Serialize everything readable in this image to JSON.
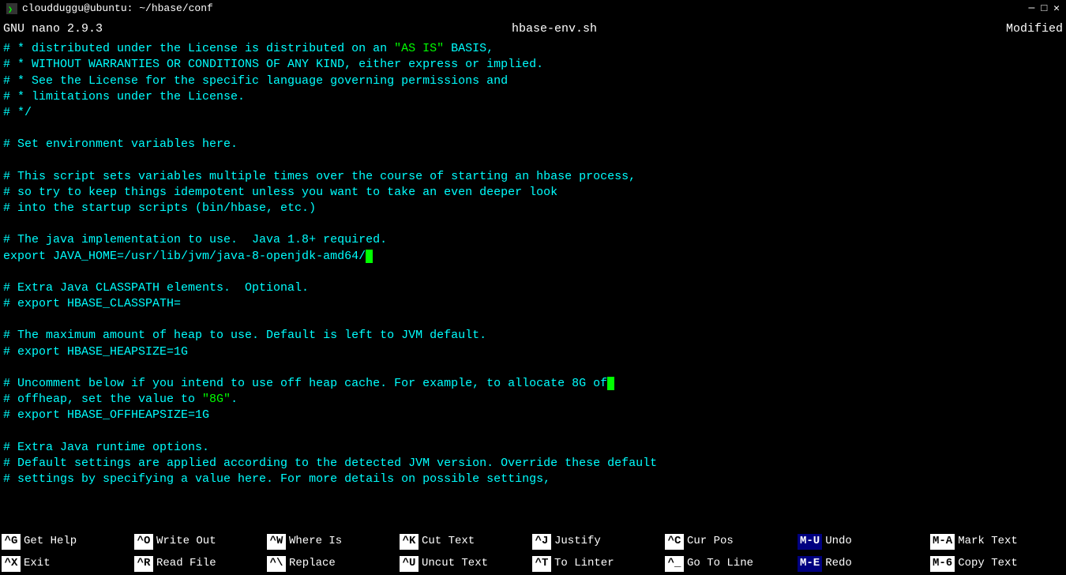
{
  "titlebar": {
    "title": "cloudduggu@ubuntu: ~/hbase/conf",
    "icon": "terminal"
  },
  "header": {
    "version": "GNU nano 2.9.3",
    "filename": "hbase-env.sh",
    "status": "Modified"
  },
  "editor": {
    "lines": [
      "# * distributed under the License is distributed on an \"AS IS\" BASIS,",
      "# * WITHOUT WARRANTIES OR CONDITIONS OF ANY KIND, either express or implied.",
      "# * See the License for the specific language governing permissions and",
      "# * limitations under the License.",
      "# */",
      "",
      "# Set environment variables here.",
      "",
      "# This script sets variables multiple times over the course of starting an hbase process,",
      "# so try to keep things idempotent unless you want to take an even deeper look",
      "# into the startup scripts (bin/hbase, etc.)",
      "",
      "# The java implementation to use.  Java 1.8+ required.",
      "export JAVA_HOME=/usr/lib/jvm/java-8-openjdk-amd64/",
      "",
      "# Extra Java CLASSPATH elements.  Optional.",
      "# export HBASE_CLASSPATH=",
      "",
      "# The maximum amount of heap to use. Default is left to JVM default.",
      "# export HBASE_HEAPSIZE=1G",
      "",
      "# Uncomment below if you intend to use off heap cache. For example, to allocate 8G of",
      "# offheap, set the value to \"8G\".",
      "# export HBASE_OFFHEAPSIZE=1G",
      "",
      "# Extra Java runtime options.",
      "# Default settings are applied according to the detected JVM version. Override these default",
      "# settings by specifying a value here. For more details on possible settings,"
    ]
  },
  "shortcuts": [
    {
      "key": "^G",
      "label": "Get Help"
    },
    {
      "key": "^O",
      "label": "Write Out"
    },
    {
      "key": "^W",
      "label": "Where Is"
    },
    {
      "key": "^K",
      "label": "Cut Text"
    },
    {
      "key": "^J",
      "label": "Justify"
    },
    {
      "key": "^C",
      "label": "Cur Pos"
    },
    {
      "key": "M-U",
      "label": "Undo"
    },
    {
      "key": "M-A",
      "label": "Mark Text"
    },
    {
      "key": "^X",
      "label": "Exit"
    },
    {
      "key": "^R",
      "label": "Read File"
    },
    {
      "key": "^\\",
      "label": "Replace"
    },
    {
      "key": "^U",
      "label": "Uncut Text"
    },
    {
      "key": "^T",
      "label": "To Linter"
    },
    {
      "key": "^_",
      "label": "Go To Line"
    },
    {
      "key": "M-E",
      "label": "Redo"
    },
    {
      "key": "M-6",
      "label": "Copy Text"
    }
  ]
}
